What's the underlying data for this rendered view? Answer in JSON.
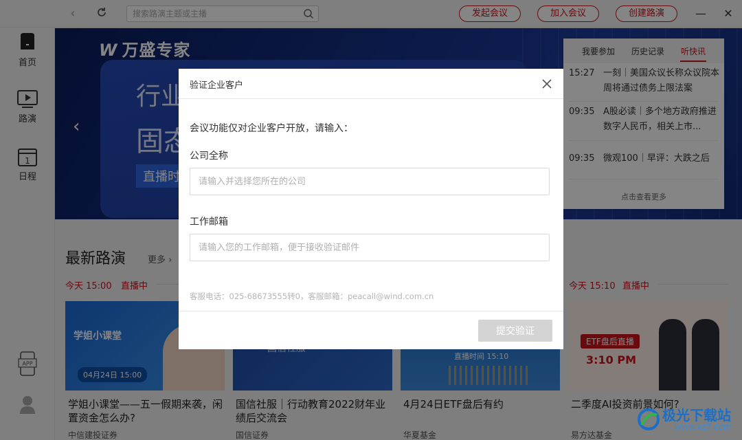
{
  "topbar": {
    "search_placeholder": "搜索路演主题或主播",
    "btn_start": "发起会议",
    "btn_join": "加入会议",
    "btn_create": "创建路演"
  },
  "sidebar": {
    "items": [
      {
        "label": "首页",
        "icon": "home-icon"
      },
      {
        "label": "路演",
        "icon": "play-icon"
      },
      {
        "label": "日程",
        "icon": "calendar-icon"
      }
    ],
    "app_label": "APP"
  },
  "banner": {
    "brand": "万盛专家",
    "line1": "行业",
    "line2": "固态",
    "tag": "直播时"
  },
  "news": {
    "tabs": [
      "我要参加",
      "历史记录",
      "听快讯"
    ],
    "active_tab": 2,
    "items": [
      {
        "time": "15:27",
        "text": "一刻｜美国众议长称众议院本周将通过债务上限法案"
      },
      {
        "time": "09:35",
        "text": "A股必读｜多个地方政府推进数字人民币，相关上市..."
      },
      {
        "time": "09:35",
        "text": "微观100｜早评：大跌之后"
      }
    ],
    "more": "点击查看更多"
  },
  "section": {
    "title": "最新路演",
    "more": "更多",
    "time_left": "今天 15:00",
    "live_left": "直播中",
    "time_right": "今天 15:10",
    "live_right": "直播中"
  },
  "cards": [
    {
      "title": "学姐小课堂——五一假期来袭，闲置资金怎么办?",
      "org": "中信建投证券",
      "img_text": "学姐小课堂",
      "img_date": "04月24日 15:00"
    },
    {
      "title": "国信社服｜行动教育2022财年业绩后交流会",
      "org": "国信证券",
      "img_text": "国信社服"
    },
    {
      "title": "4月24日ETF盘后有约",
      "org": "华夏基金",
      "img_text": "直播时间  15:10"
    },
    {
      "title": "二季度AI投资前景如何?",
      "org": "易方达基金",
      "img_text": "ETF盘后直播",
      "img_time": "3:10 PM"
    }
  ],
  "modal": {
    "title": "验证企业客户",
    "intro": "会议功能仅对企业客户开放，请输入：",
    "company_label": "公司全称",
    "company_placeholder": "请输入并选择您所在的公司",
    "email_label": "工作邮箱",
    "email_placeholder": "请输入您的工作邮箱，便于接收验证邮件",
    "contact": "客服电话：025-68673555转0，客服邮箱：peacall@wind.com.cn",
    "submit": "提交验证"
  },
  "watermark": {
    "text": "极光下载站",
    "sub": "www.xz7.com"
  },
  "colors": {
    "accent": "#c9141e",
    "banner": "#16318a",
    "submit_disabled": "#d4d4d4"
  }
}
